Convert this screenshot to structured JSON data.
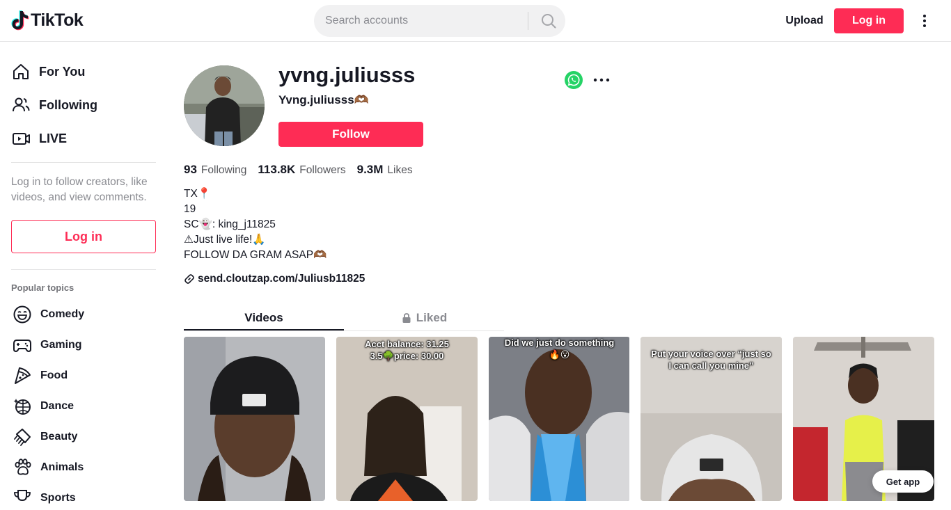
{
  "header": {
    "logo_text": "TikTok",
    "search_placeholder": "Search accounts",
    "upload_label": "Upload",
    "login_label": "Log in"
  },
  "sidebar": {
    "nav": [
      {
        "label": "For You",
        "icon": "home-icon"
      },
      {
        "label": "Following",
        "icon": "people-icon"
      },
      {
        "label": "LIVE",
        "icon": "live-icon"
      }
    ],
    "hint": "Log in to follow creators, like videos, and view comments.",
    "login_label": "Log in",
    "topics_title": "Popular topics",
    "topics": [
      {
        "label": "Comedy",
        "icon": "smile-icon"
      },
      {
        "label": "Gaming",
        "icon": "gamepad-icon"
      },
      {
        "label": "Food",
        "icon": "pizza-icon"
      },
      {
        "label": "Dance",
        "icon": "disco-ball-icon"
      },
      {
        "label": "Beauty",
        "icon": "comb-icon"
      },
      {
        "label": "Animals",
        "icon": "paw-icon"
      },
      {
        "label": "Sports",
        "icon": "trophy-icon"
      }
    ]
  },
  "profile": {
    "username": "yvng.juliusss",
    "nickname": "Yvng.juliusss🫶🏾",
    "follow_label": "Follow",
    "stats": [
      {
        "value": "93",
        "label": "Following"
      },
      {
        "value": "113.8K",
        "label": "Followers"
      },
      {
        "value": "9.3M",
        "label": "Likes"
      }
    ],
    "bio": [
      "TX📍",
      "19",
      "SC👻: king_j11825",
      "⚠Just live life!🙏",
      "FOLLOW DA GRAM ASAP🫶🏾"
    ],
    "link": "send.cloutzap.com/Juliusb11825"
  },
  "tabs": {
    "videos": "Videos",
    "liked": "Liked"
  },
  "videos": [
    {
      "caption": ""
    },
    {
      "caption": "Acct balance: 31.25\n3.5🌳price: 30.00"
    },
    {
      "caption": "Did we just do something\n🔥😮"
    },
    {
      "caption": "Put your voice over “just so\nI can call you mine”"
    },
    {
      "caption": ""
    }
  ],
  "get_app_label": "Get app",
  "colors": {
    "accent": "#fe2c55",
    "text": "#161823",
    "muted": "#8a8b91",
    "share_green": "#25d366"
  }
}
